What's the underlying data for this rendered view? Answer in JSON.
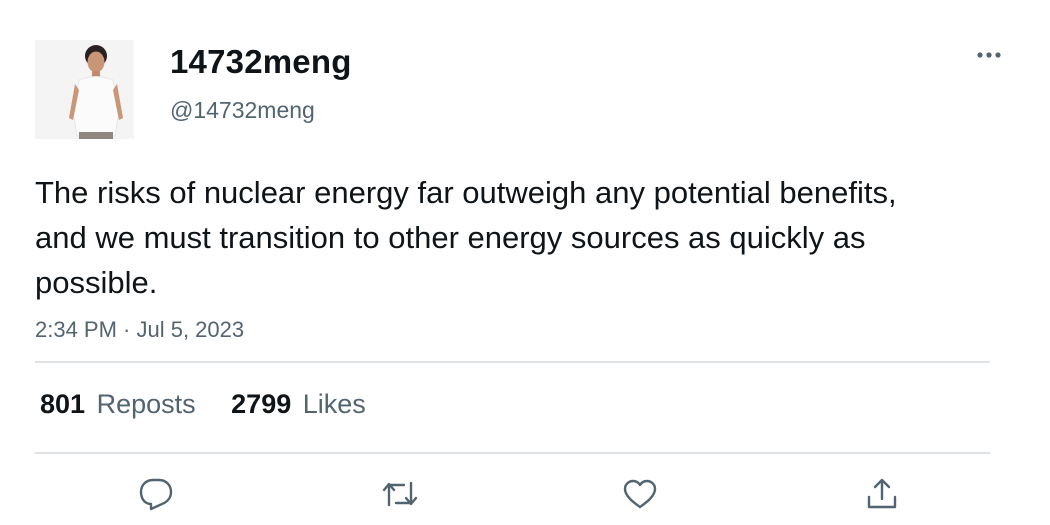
{
  "author": {
    "display_name": "14732meng",
    "handle": "@14732meng",
    "avatar_icon": "person-photo"
  },
  "tweet": {
    "text": "The risks of nuclear energy far outweigh any potential benefits, and we must transition to other energy sources as quickly as possible.",
    "timestamp": "2:34 PM · Jul 5, 2023"
  },
  "stats": {
    "reposts_count": "801",
    "reposts_label": "Reposts",
    "likes_count": "2799",
    "likes_label": "Likes"
  },
  "actions": {
    "reply_icon": "reply-icon",
    "repost_icon": "repost-icon",
    "like_icon": "like-icon",
    "share_icon": "share-icon"
  },
  "colors": {
    "text_primary": "#0f1419",
    "text_secondary": "#536471",
    "divider": "#dfe3e6"
  }
}
